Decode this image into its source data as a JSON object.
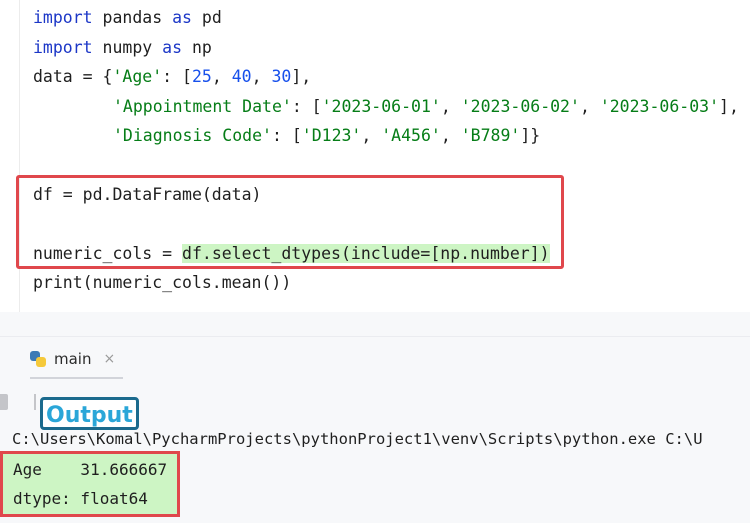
{
  "code": {
    "line1": {
      "kw1": "import",
      "mod": " pandas ",
      "kw2": "as",
      "alias": " pd"
    },
    "line2": {
      "kw1": "import",
      "mod": " numpy ",
      "kw2": "as",
      "alias": " np"
    },
    "line3": {
      "a": "data = {",
      "s1": "'Age'",
      "b": ": [",
      "n1": "25",
      "c1": ", ",
      "n2": "40",
      "c2": ", ",
      "n3": "30",
      "e": "],"
    },
    "line4": {
      "s1": "'Appointment Date'",
      "b": ": [",
      "s2": "'2023-06-01'",
      "c1": ", ",
      "s3": "'2023-06-02'",
      "c2": ", ",
      "s4": "'2023-06-03'",
      "e": "],"
    },
    "line5": {
      "s1": "'Diagnosis Code'",
      "b": ": [",
      "s2": "'D123'",
      "c1": ", ",
      "s3": "'A456'",
      "c2": ", ",
      "s4": "'B789'",
      "e": "]}"
    },
    "line6": "df = pd.DataFrame(data)",
    "line7": {
      "a": "numeric_cols = ",
      "call_pre": "df.select_dtypes(include=[np.number",
      "call_end": "])"
    },
    "line8": "print(numeric_cols.mean())"
  },
  "run_panel": {
    "tab_label": "main",
    "tab_close": "×",
    "output_label": "Output",
    "run_command": "C:\\Users\\Komal\\PycharmProjects\\pythonProject1\\venv\\Scripts\\python.exe C:\\U",
    "output_lines": [
      "Age    31.666667",
      "dtype: float64"
    ]
  },
  "colors": {
    "highlight": "#cdf5c4",
    "annotation_red": "#e0474c",
    "output_label_text": "#2aa6d8",
    "output_label_border": "#1b6a8d"
  }
}
